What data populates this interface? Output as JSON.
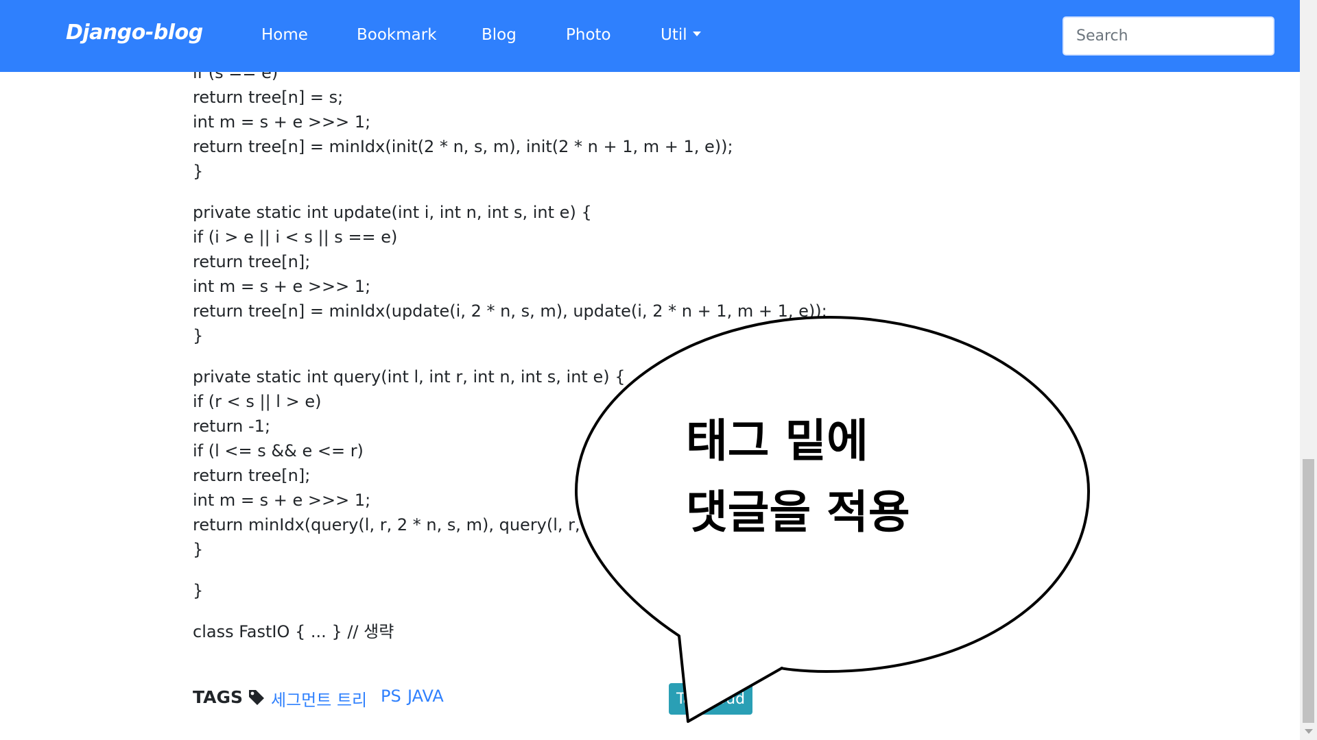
{
  "navbar": {
    "brand": "Django-blog",
    "items": [
      "Home",
      "Bookmark",
      "Blog",
      "Photo",
      "Util"
    ],
    "search_placeholder": "Search"
  },
  "code_lines": [
    "if (s == e)",
    "return tree[n] = s;",
    "int m = s + e >>> 1;",
    "return tree[n] = minIdx(init(2 * n, s, m), init(2 * n + 1, m + 1, e));",
    "}",
    "private static int update(int i, int n, int s, int e) {",
    "if (i > e || i < s || s == e)",
    "return tree[n];",
    "int m = s + e >>> 1;",
    "return tree[n] = minIdx(update(i, 2 * n, s, m), update(i, 2 * n + 1, m + 1, e));",
    "}",
    "private static int query(int l, int r, int n, int s, int e) {",
    "if (r < s || l > e)",
    "return -1;",
    "if (l <= s && e <= r)",
    "return tree[n];",
    "int m = s + e >>> 1;",
    "return minIdx(query(l, r, 2 * n, s, m), query(l, r, 2 * n + 1, m + 1, e));",
    "}",
    "}",
    "class FastIO { ... } // 생략"
  ],
  "tags": {
    "label": "TAGS",
    "icon": "tag-icon",
    "links": [
      "세그먼트 트리",
      "PS",
      "JAVA"
    ],
    "tagcloud_label": "TagCloud"
  },
  "bubble": {
    "line1": "태그 밑에",
    "line2": "댓글을 적용"
  },
  "colors": {
    "navbar": "#2f80fd",
    "link": "#2f80fd",
    "tagcloud": "#2a9fb5"
  }
}
